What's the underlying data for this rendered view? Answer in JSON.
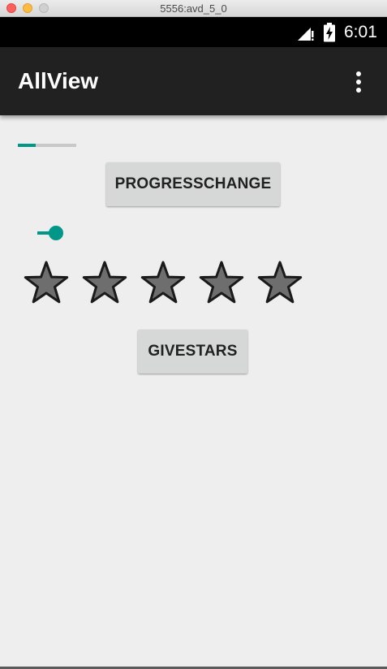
{
  "window": {
    "title": "5556:avd_5_0"
  },
  "status_bar": {
    "time": "6:01",
    "icons": [
      "signal-icon",
      "battery-charging-icon"
    ]
  },
  "app_bar": {
    "title": "AllView",
    "menu_icon": "overflow-menu-icon"
  },
  "content": {
    "progress": {
      "value": 0.3
    },
    "progress_button_label": "PROGRESSCHANGE",
    "seekbar": {
      "value": 0.2
    },
    "rating": {
      "stars": 5,
      "value": 0
    },
    "stars_button_label": "GIVESTARS"
  },
  "colors": {
    "accent": "#009688",
    "app_bar": "#212121",
    "status_bar": "#000000",
    "background": "#eeeeee",
    "button": "#d6d7d7",
    "star_fill": "#6e6e6e",
    "star_stroke": "#1a1a1a"
  }
}
